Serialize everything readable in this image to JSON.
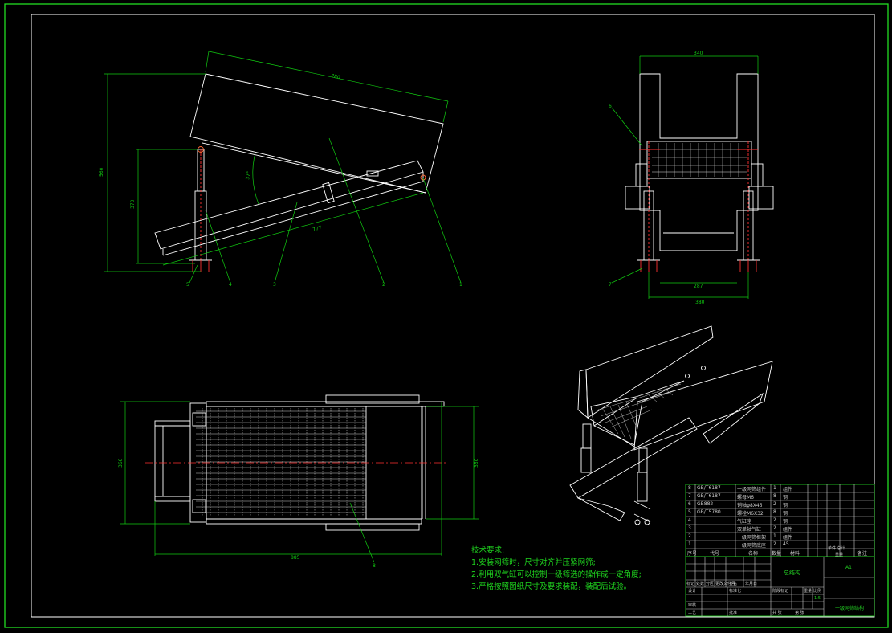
{
  "colors": {
    "background": "#000000",
    "frame": "#22dd22",
    "dimension": "#11cc11",
    "geometry": "#ffffff",
    "centerline": "#ff3030"
  },
  "dimensions": {
    "side_view": {
      "top": "780",
      "height": "560",
      "inner_height": "370",
      "angle": "37°",
      "base": "777"
    },
    "front_view": {
      "top": "340",
      "inner": "287",
      "bottom": "380"
    },
    "top_view": {
      "height": "360",
      "right_height": "350",
      "length": "885"
    }
  },
  "balloons": {
    "side_view": [
      "5",
      "4",
      "3",
      "2",
      "1"
    ],
    "front_view": [
      "6",
      "7"
    ],
    "top_view": [
      "8"
    ]
  },
  "notes": {
    "title": "技术要求:",
    "items": [
      "1.安装网筛时，尺寸对齐并压紧网筛;",
      "2.利用双气缸可以控制一级筛选的操作成一定角度;",
      "3.严格按照图纸尺寸及要求装配，装配后试验。"
    ]
  },
  "bom": {
    "rows": [
      {
        "no": "8",
        "code": "GB/T6187",
        "name": "一级网筛组件",
        "qty": "1",
        "material": "组件"
      },
      {
        "no": "7",
        "code": "GB/T6187",
        "name": "螺母M6",
        "qty": "8",
        "material": "钢"
      },
      {
        "no": "6",
        "code": "GB882",
        "name": "销轴φ8X45",
        "qty": "2",
        "material": "钢"
      },
      {
        "no": "5",
        "code": "GB/T5780",
        "name": "螺栓M6X32",
        "qty": "8",
        "material": "钢"
      },
      {
        "no": "4",
        "code": "",
        "name": "气缸座",
        "qty": "2",
        "material": "钢"
      },
      {
        "no": "3",
        "code": "",
        "name": "双单轴气缸",
        "qty": "2",
        "material": "组件"
      },
      {
        "no": "2",
        "code": "",
        "name": "一级网筛框架",
        "qty": "1",
        "material": "组件"
      },
      {
        "no": "1",
        "code": "",
        "name": "一级网筛底座",
        "qty": "2",
        "material": "45"
      }
    ],
    "header": {
      "no": "序号",
      "code": "代号",
      "name": "名称",
      "qty": "数量",
      "material": "材料",
      "weight": "单件 总计",
      "weight2": "重量",
      "remark": "备注"
    }
  },
  "title_block": {
    "drawing_name": "总结构",
    "paper": "A1",
    "part_name": "一级网筛结构",
    "labels": {
      "mark": "标记",
      "count": "处数",
      "zone": "分区",
      "change_doc": "更改文件号",
      "sign": "签名",
      "date": "年月日",
      "design": "设计",
      "standard": "标准化",
      "stage": "阶段标记",
      "weight": "重量",
      "scale": "比例",
      "review": "审核",
      "process": "工艺",
      "approve": "批准",
      "sheet_total": "共 张",
      "sheet_no": "第 张"
    },
    "scale_value": "1:5"
  }
}
